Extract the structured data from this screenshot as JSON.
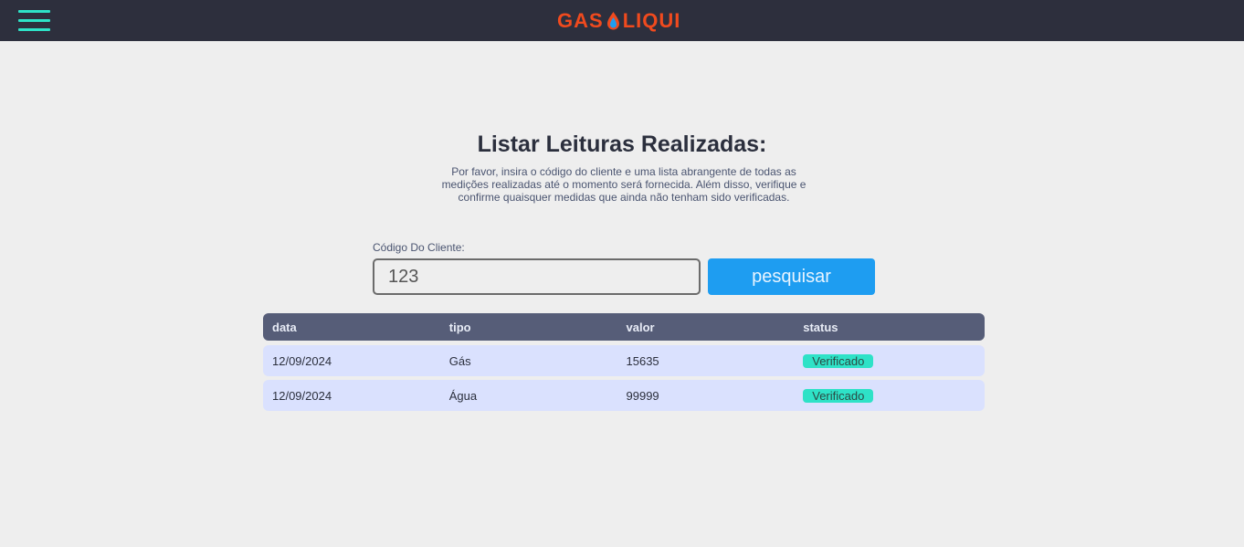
{
  "header": {
    "logo_left": "GAS",
    "logo_right": "LIQUI",
    "colors": {
      "background": "#2d2f3d",
      "accent": "#2ee2c7",
      "logo": "#f04a1e"
    },
    "menu_icon": "hamburger-icon"
  },
  "main": {
    "title": "Listar Leituras Realizadas:",
    "subtitle": "Por favor, insira o código do cliente e uma lista abrangente de todas as medições realizadas até o momento será fornecida. Além disso, verifique e confirme quaisquer medidas que ainda não tenham sido verificadas.",
    "search": {
      "label": "Código Do Cliente:",
      "value": "123",
      "button_label": "pesquisar",
      "button_color": "#1e9df1"
    },
    "table": {
      "columns": [
        "data",
        "tipo",
        "valor",
        "status"
      ],
      "rows": [
        {
          "data": "12/09/2024",
          "tipo": "Gás",
          "valor": "15635",
          "status": "Verificado"
        },
        {
          "data": "12/09/2024",
          "tipo": "Água",
          "valor": "99999",
          "status": "Verificado"
        }
      ]
    }
  }
}
